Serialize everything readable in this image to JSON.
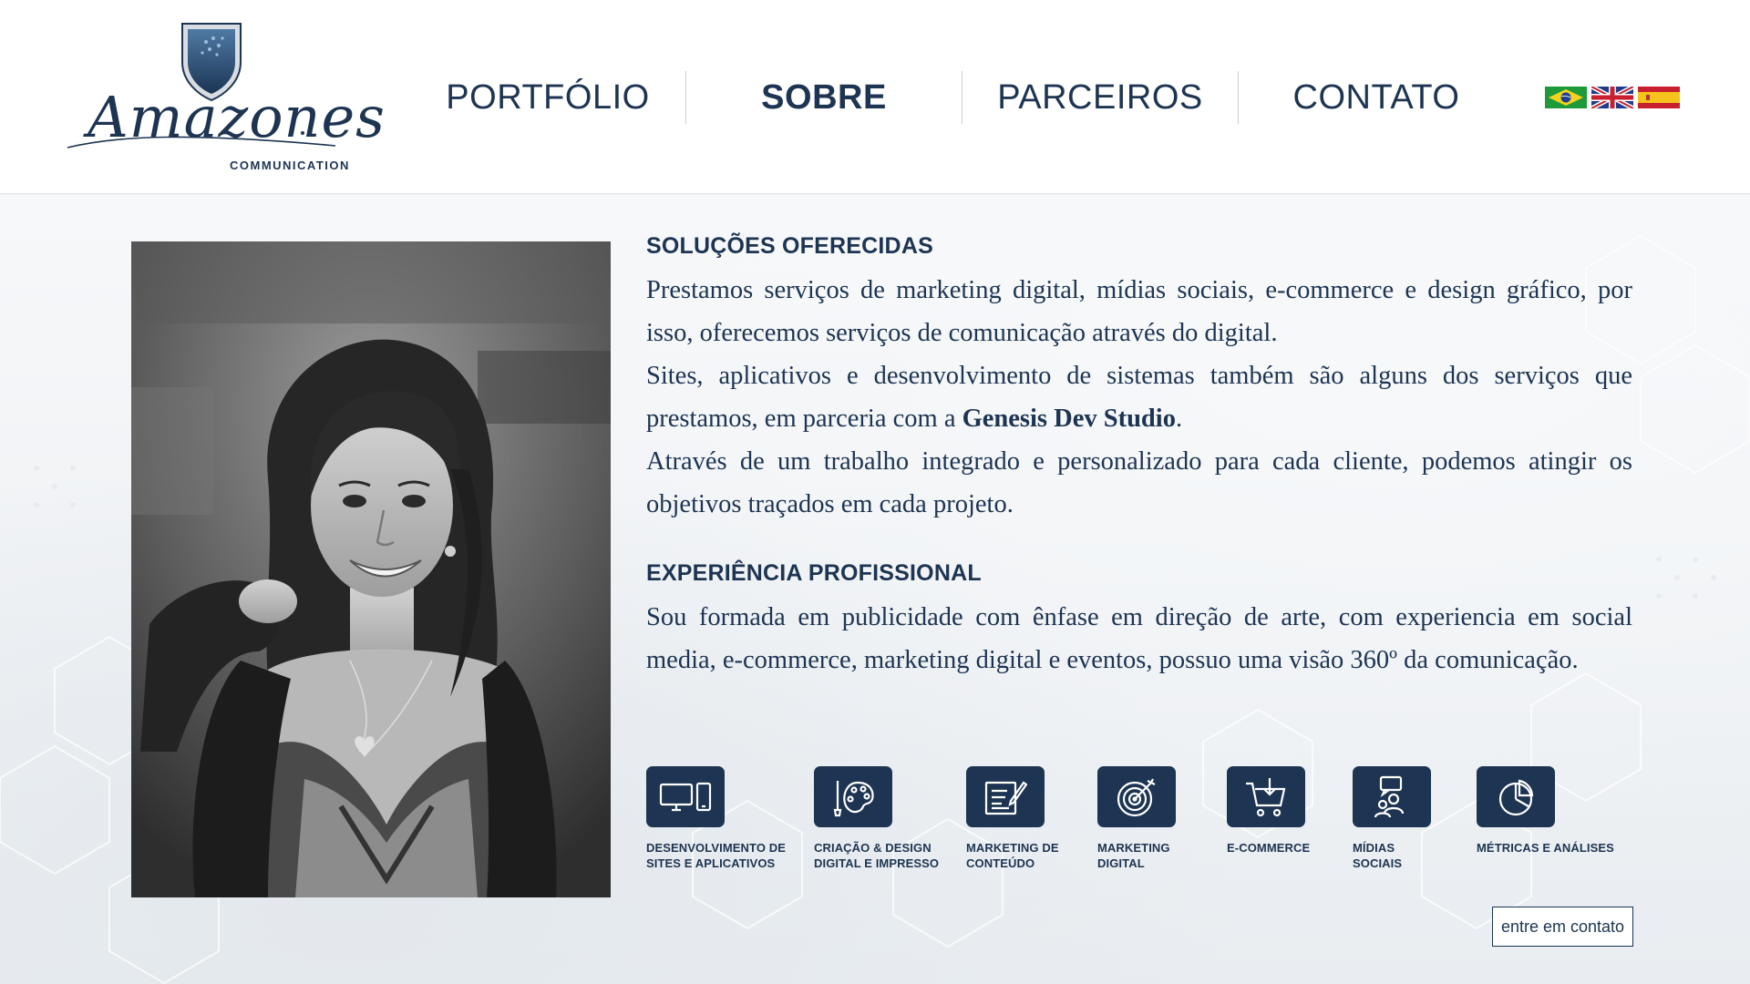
{
  "brand": {
    "name": "Amazones",
    "tagline": "COMMUNICATION"
  },
  "nav": {
    "items": [
      "PORTFÓLIO",
      "SOBRE",
      "PARCEIROS",
      "CONTATO"
    ],
    "active": "SOBRE"
  },
  "languages": [
    "brazil-flag-icon",
    "uk-flag-icon",
    "spain-flag-icon"
  ],
  "photo": {
    "alt": "grayscale-portrait"
  },
  "solutions": {
    "title": "SOLUÇÕES OFERECIDAS",
    "p1": "Prestamos serviços de marketing digital, mídias sociais, e-commerce e design gráfico, por isso, oferecemos serviços de comunicação através do digital.",
    "p2_before": "Sites, aplicativos e desenvolvimento de sistemas também são alguns dos serviços que prestamos, em parceria com a ",
    "p2_bold": "Genesis Dev Studio",
    "p2_after": ".",
    "p3": "Através de um trabalho integrado e personalizado para cada cliente, podemos atingir os objetivos traçados em cada projeto."
  },
  "experience": {
    "title": "EXPERIÊNCIA PROFISSIONAL",
    "p1": "Sou formada em publicidade com ênfase em direção de arte, com experiencia em social media, e-commerce, marketing digital e eventos, possuo uma visão 360º da comunicação."
  },
  "services": [
    {
      "label": "DESENVOLVIMENTO DE\nSITES E APLICATIVOS",
      "icon": "devices-icon"
    },
    {
      "label": "CRIAÇÃO & DESIGN\nDIGITAL E IMPRESSO",
      "icon": "palette-icon"
    },
    {
      "label": "MARKETING DE\nCONTEÚDO",
      "icon": "document-pen-icon"
    },
    {
      "label": "MARKETING\nDIGITAL",
      "icon": "target-icon"
    },
    {
      "label": "E-COMMERCE",
      "icon": "cart-icon"
    },
    {
      "label": "MÍDIAS\nSOCIAIS",
      "icon": "people-icon"
    },
    {
      "label": "MÉTRICAS E ANÁLISES",
      "icon": "pie-chart-icon"
    }
  ],
  "cta": {
    "label": "entre em contato"
  },
  "colors": {
    "brand_navy": "#1d3452",
    "background": "#eef1f4",
    "header_bg": "#ffffff"
  }
}
